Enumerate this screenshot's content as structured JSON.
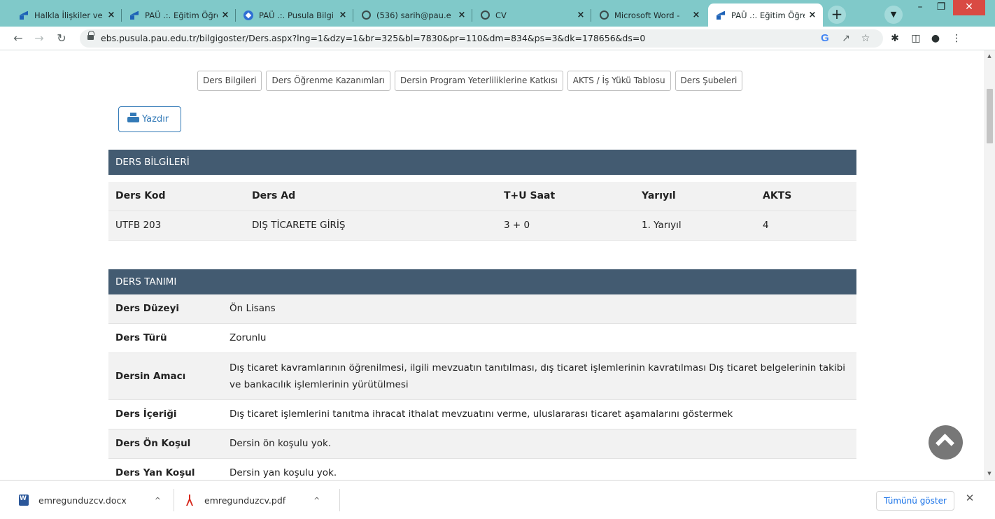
{
  "browser": {
    "tabs": [
      {
        "title": "Halkla İlişkiler ve T",
        "favicon": "pau-icon"
      },
      {
        "title": "PAÜ .:. Eğitim Öğre",
        "favicon": "pau-icon"
      },
      {
        "title": "PAÜ .:. Pusula Bilgi",
        "favicon": "compass-icon"
      },
      {
        "title": "(536) sarih@pau.e",
        "favicon": "globe-icon"
      },
      {
        "title": "CV",
        "favicon": "globe-icon"
      },
      {
        "title": "Microsoft Word - ",
        "favicon": "globe-icon"
      },
      {
        "title": "PAÜ .:. Eğitim Öğre",
        "favicon": "pau-icon",
        "active": true
      }
    ],
    "close_glyph": "×",
    "new_tab": "+",
    "url": "ebs.pusula.pau.edu.tr/bilgigoster/Ders.aspx?lng=1&dzy=1&br=325&bl=7830&pr=110&dm=834&ps=3&dk=178656&ds=0",
    "accent_color": "#80c9c9"
  },
  "nav_buttons": {
    "ders_bilgileri": "Ders Bilgileri",
    "ogrenme": "Ders Öğrenme Kazanımları",
    "program": "Dersin Program Yeterliliklerine Katkısı",
    "akts": "AKTS / İş Yükü Tablosu",
    "subeler": "Ders Şubeleri"
  },
  "print_label": "Yazdır",
  "ders_bilgileri": {
    "header": "DERS BİLGİLERİ",
    "columns": [
      "Ders Kod",
      "Ders Ad",
      "T+U Saat",
      "Yarıyıl",
      "AKTS"
    ],
    "row": [
      "UTFB 203",
      "DIŞ TİCARETE GİRİŞ",
      "3 + 0",
      "1. Yarıyıl",
      "4"
    ]
  },
  "ders_tanimi": {
    "header": "DERS TANIMI",
    "rows": [
      {
        "key": "Ders Düzeyi",
        "value": "Ön Lisans"
      },
      {
        "key": "Ders Türü",
        "value": "Zorunlu"
      },
      {
        "key": "Dersin Amacı",
        "value": "Dış ticaret kavramlarının öğrenilmesi, ilgili mevzuatın tanıtılması, dış ticaret işlemlerinin kavratılması Dış ticaret belgelerinin takibi ve bankacılık işlemlerinin yürütülmesi"
      },
      {
        "key": "Ders İçeriği",
        "value": "Dış ticaret işlemlerini tanıtma ihracat ithalat mevzuatını verme, uluslararası ticaret aşamalarını göstermek"
      },
      {
        "key": "Ders Ön Koşul",
        "value": "Dersin ön koşulu yok."
      },
      {
        "key": "Ders Yan Koşul",
        "value": "Dersin yan koşulu yok."
      }
    ],
    "header_color": "#435b71"
  },
  "downloads": {
    "items": [
      {
        "name": "emregunduzcv.docx",
        "icon": "word-file-icon"
      },
      {
        "name": "emregunduzcv.pdf",
        "icon": "pdf-file-icon"
      }
    ],
    "show_all": "Tümünü göster"
  }
}
